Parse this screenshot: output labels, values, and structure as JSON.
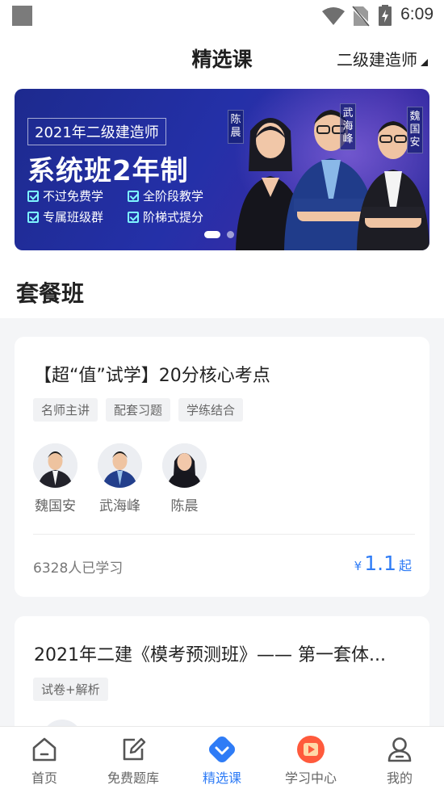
{
  "status_bar": {
    "time": "6:09"
  },
  "header": {
    "title": "精选课",
    "certificate": "二级建造师"
  },
  "banner": {
    "year_label": "2021年二级建造师",
    "headline": "系统班2年制",
    "features": [
      "不过免费学",
      "全阶段教学",
      "专属班级群",
      "阶梯式提分"
    ],
    "teachers": [
      "陈晨",
      "武海峰",
      "魏国安"
    ],
    "slide_index": 1,
    "slide_count": 2
  },
  "section": {
    "title": "套餐班"
  },
  "courses": [
    {
      "title": "【超“值”试学】20分核心考点",
      "tags": [
        "名师主讲",
        "配套习题",
        "学练结合"
      ],
      "teachers": [
        "魏国安",
        "武海峰",
        "陈晨"
      ],
      "learners": "6328人已学习",
      "price_symbol": "¥",
      "price": "1.1",
      "price_suffix": "起"
    },
    {
      "title": "2021年二建《模考预测班》—— 第一套体...",
      "tags": [
        "试卷+解析"
      ]
    }
  ],
  "tabbar": {
    "items": [
      {
        "label": "首页",
        "icon": "home-icon"
      },
      {
        "label": "免费题库",
        "icon": "edit-icon"
      },
      {
        "label": "精选课",
        "icon": "selected-course-icon"
      },
      {
        "label": "学习中心",
        "icon": "play-icon"
      },
      {
        "label": "我的",
        "icon": "profile-icon"
      }
    ],
    "active_index": 2,
    "accent_color": "#2f7cf6"
  }
}
